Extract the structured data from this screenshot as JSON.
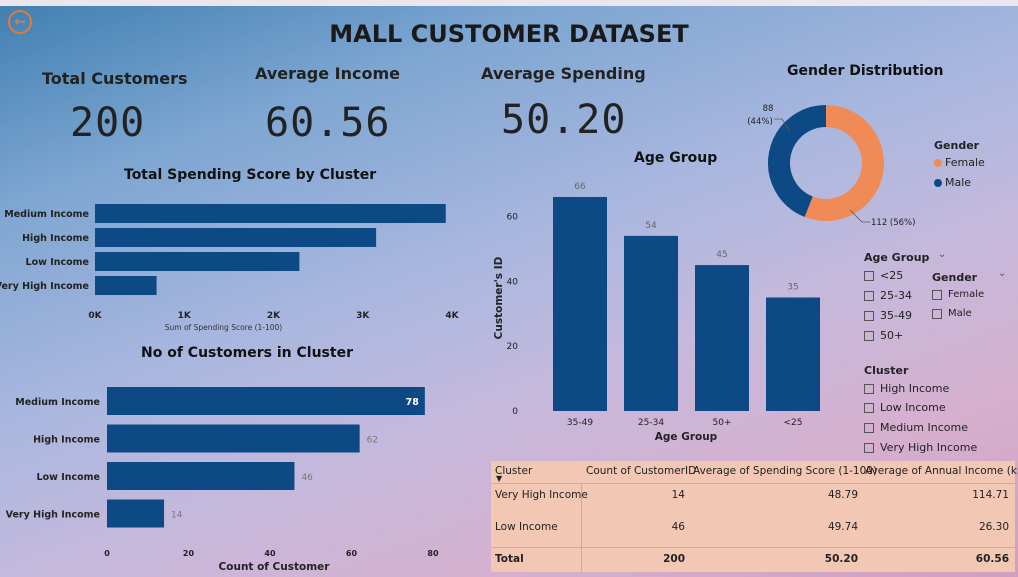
{
  "title": "MALL CUSTOMER DATASET",
  "kpis": {
    "total_customers_label": "Total Customers",
    "total_customers_value": "200",
    "avg_income_label": "Average Income",
    "avg_income_value": "60.56",
    "avg_spending_label": "Average Spending",
    "avg_spending_value": "50.20"
  },
  "colors": {
    "bar": "#0d4a85",
    "female": "#f08a57",
    "male": "#0d4a85"
  },
  "spending_chart": {
    "title": "Total Spending Score by Cluster",
    "xlabel": "Sum of Spending Score (1-100)",
    "ticks": [
      "0K",
      "1K",
      "2K",
      "3K",
      "4K"
    ]
  },
  "customers_chart": {
    "title": "No of Customers in Cluster",
    "xlabel": "Count of Customer",
    "ticks": [
      "0",
      "20",
      "40",
      "60",
      "80"
    ]
  },
  "age_chart": {
    "title": "Age Group",
    "xlabel": "Age Group",
    "ylabel": "Customer's ID",
    "ticks": [
      "0",
      "20",
      "40",
      "60"
    ]
  },
  "gender_chart": {
    "title": "Gender Distribution",
    "male_label_line1": "88",
    "male_label_line2": "(44%)",
    "female_label": "112 (56%)",
    "legend_title": "Gender",
    "legend_female": "Female",
    "legend_male": "Male"
  },
  "chart_data": [
    {
      "type": "bar",
      "title": "Total Spending Score by Cluster",
      "orientation": "horizontal",
      "categories": [
        "Medium Income",
        "High Income",
        "Low Income",
        "Very High Income"
      ],
      "values": [
        3930,
        3150,
        2290,
        690
      ],
      "xlabel": "Sum of Spending Score (1-100)",
      "xlim": [
        0,
        4000
      ]
    },
    {
      "type": "bar",
      "title": "No of Customers in Cluster",
      "orientation": "horizontal",
      "categories": [
        "Medium Income",
        "High Income",
        "Low Income",
        "Very High Income"
      ],
      "values": [
        78,
        62,
        46,
        14
      ],
      "xlabel": "Count of Customer",
      "xlim": [
        0,
        80
      ]
    },
    {
      "type": "bar",
      "title": "Age Group",
      "categories": [
        "35-49",
        "25-34",
        "50+",
        "<25"
      ],
      "values": [
        66,
        54,
        45,
        35
      ],
      "xlabel": "Age Group",
      "ylabel": "Customer's ID",
      "ylim": [
        0,
        70
      ]
    },
    {
      "type": "pie",
      "title": "Gender Distribution",
      "categories": [
        "Female",
        "Male"
      ],
      "values": [
        112,
        88
      ],
      "donut": true,
      "legend": "right"
    }
  ],
  "slicers": {
    "age_group": {
      "title": "Age Group",
      "options": [
        "<25",
        "25-34",
        "35-49",
        "50+"
      ]
    },
    "gender": {
      "title": "Gender",
      "options": [
        "Female",
        "Male"
      ]
    },
    "cluster": {
      "title": "Cluster",
      "options": [
        "High Income",
        "Low Income",
        "Medium Income",
        "Very High Income"
      ]
    }
  },
  "table": {
    "headers": [
      "Cluster",
      "Count of CustomerID",
      "Average of Spending Score (1-100)",
      "Average of Annual Income (k$)"
    ],
    "rows": [
      [
        "Very High Income",
        "14",
        "48.79",
        "114.71"
      ],
      [
        "Low Income",
        "46",
        "49.74",
        "26.30"
      ]
    ],
    "total": [
      "Total",
      "200",
      "50.20",
      "60.56"
    ]
  }
}
